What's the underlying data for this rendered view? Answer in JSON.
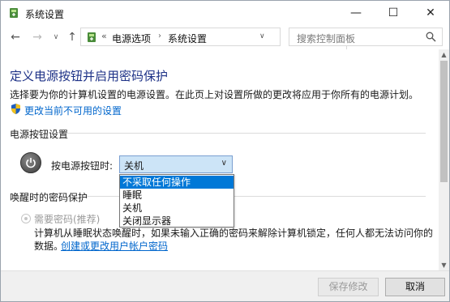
{
  "window": {
    "title": "系统设置",
    "controls": {
      "minimize": "—",
      "maximize": "☐",
      "close": "✕"
    }
  },
  "nav": {
    "back": "←",
    "forward": "→",
    "recent": "∨",
    "up": "↑",
    "breadcrumb_sep": "«",
    "breadcrumbs": [
      "电源选项",
      "系统设置"
    ],
    "crumb_arrow": "›",
    "address_dropdown": "∨",
    "refresh": "↻",
    "search_placeholder": "搜索控制面板"
  },
  "main": {
    "heading": "定义电源按钮并启用密码保护",
    "description": "选择要为你的计算机设置的电源设置。在此页上对设置所做的更改将应用于你所有的电源计划。",
    "change_link": "更改当前不可用的设置",
    "power_section_title": "电源按钮设置",
    "power_button_label": "按电源按钮时:",
    "power_button_value": "关机",
    "select_arrow": "∨",
    "wake_section_title": "唤醒时的密码保护",
    "password_option": "需要密码(推荐)",
    "password_desc_line1": "计算机从睡眠状态唤醒时，如果未输入正确的密码来解除计算机锁定，任何人都无法访问你的",
    "password_desc_prefix": "数据。",
    "account_link": "创建或更改用户帐户密码"
  },
  "dropdown": {
    "options": [
      "不采取任何操作",
      "睡眠",
      "关机",
      "关闭显示器"
    ],
    "highlighted_index": 0
  },
  "scrollbar": {
    "up": "▲",
    "down": "▼"
  },
  "footer": {
    "save_label": "保存修改",
    "cancel_label": "取消"
  },
  "colors": {
    "heading": "#1e3287",
    "link": "#0066cc",
    "highlight": "#0078d7",
    "select_bg": "#cce4f7"
  }
}
